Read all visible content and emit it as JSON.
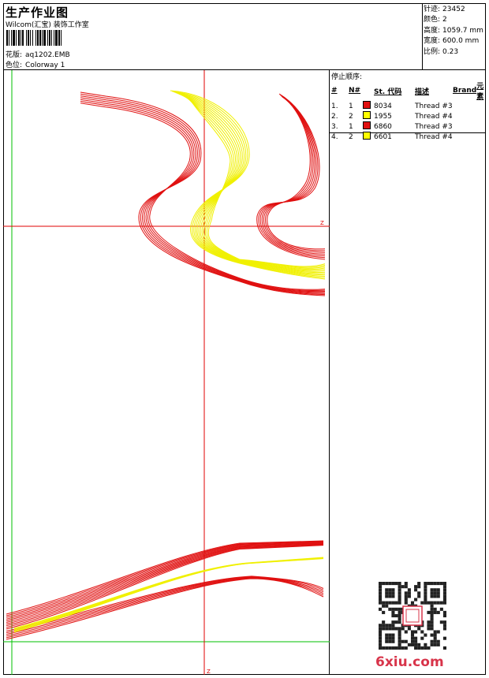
{
  "header": {
    "title": "生产作业图",
    "company": "Wilcom(汇宝) 装饰工作室",
    "design_label": "花版:",
    "design_value": "aq1202.EMB",
    "colorway_label": "色位:",
    "colorway_value": "Colorway 1"
  },
  "info": [
    {
      "label": "针迹:",
      "value": "23452"
    },
    {
      "label": "颜色:",
      "value": "2"
    },
    {
      "label": "高度:",
      "value": "1059.7 mm"
    },
    {
      "label": "宽度:",
      "value": "600.0 mm"
    },
    {
      "label": "比例:",
      "value": "0.23"
    }
  ],
  "legend": {
    "title": "停止顺序:",
    "headers": {
      "num": "#",
      "n": "N#",
      "st": "St.",
      "code": "代码",
      "desc": "描述",
      "brand": "Brand",
      "elements": "元素"
    },
    "rows": [
      {
        "num": "1.",
        "n": "1",
        "color": "#e01010",
        "code": "8034",
        "desc": "Thread #3"
      },
      {
        "num": "2.",
        "n": "2",
        "color": "#ffff00",
        "code": "1955",
        "desc": "Thread #4"
      },
      {
        "num": "3.",
        "n": "1",
        "color": "#e01010",
        "code": "6860",
        "desc": "Thread #3"
      },
      {
        "num": "4.",
        "n": "2",
        "color": "#ffff00",
        "code": "6601",
        "desc": "Thread #4"
      }
    ]
  },
  "canvas": {
    "axis_label_right": "Z",
    "axis_label_bottom": "Z",
    "guide_color_red": "#e00000",
    "guide_color_green": "#00c000",
    "thread_red": "#e01010",
    "thread_yellow": "#f0f000"
  },
  "watermark": "6xiu.com"
}
